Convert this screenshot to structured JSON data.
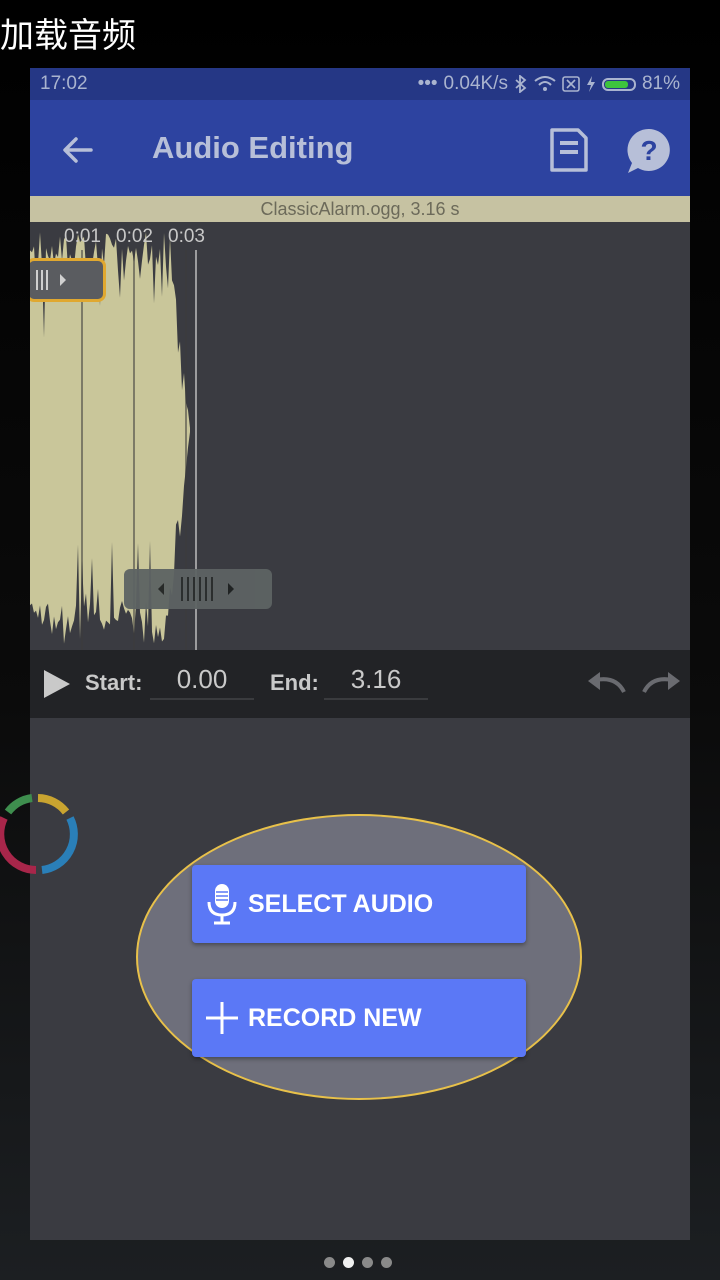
{
  "caption": "加载音频",
  "status_bar": {
    "time": "17:02",
    "network_speed": "0.04K/s",
    "battery_percent": "81%",
    "battery_level": 0.81
  },
  "app_bar": {
    "title": "Audio Editing",
    "back_icon": "arrow-left-icon",
    "save_icon": "save-file-icon",
    "help_icon": "help-bubble-icon"
  },
  "file_info": "ClassicAlarm.ogg, 3.16 s",
  "timeline_ticks": [
    "0:01",
    "0:02",
    "0:03"
  ],
  "controls": {
    "start_label": "Start:",
    "start_value": "0.00",
    "end_label": "End:",
    "end_value": "3.16"
  },
  "actions": {
    "select_audio": "SELECT AUDIO",
    "record_new": "RECORD NEW"
  },
  "pager": {
    "count": 4,
    "active_index": 1
  },
  "colors": {
    "status_bar": "#253785",
    "app_bar": "#2d43a0",
    "waveform": "#c9c69a",
    "button": "#5b78f6",
    "highlight": "#e8c14a"
  }
}
